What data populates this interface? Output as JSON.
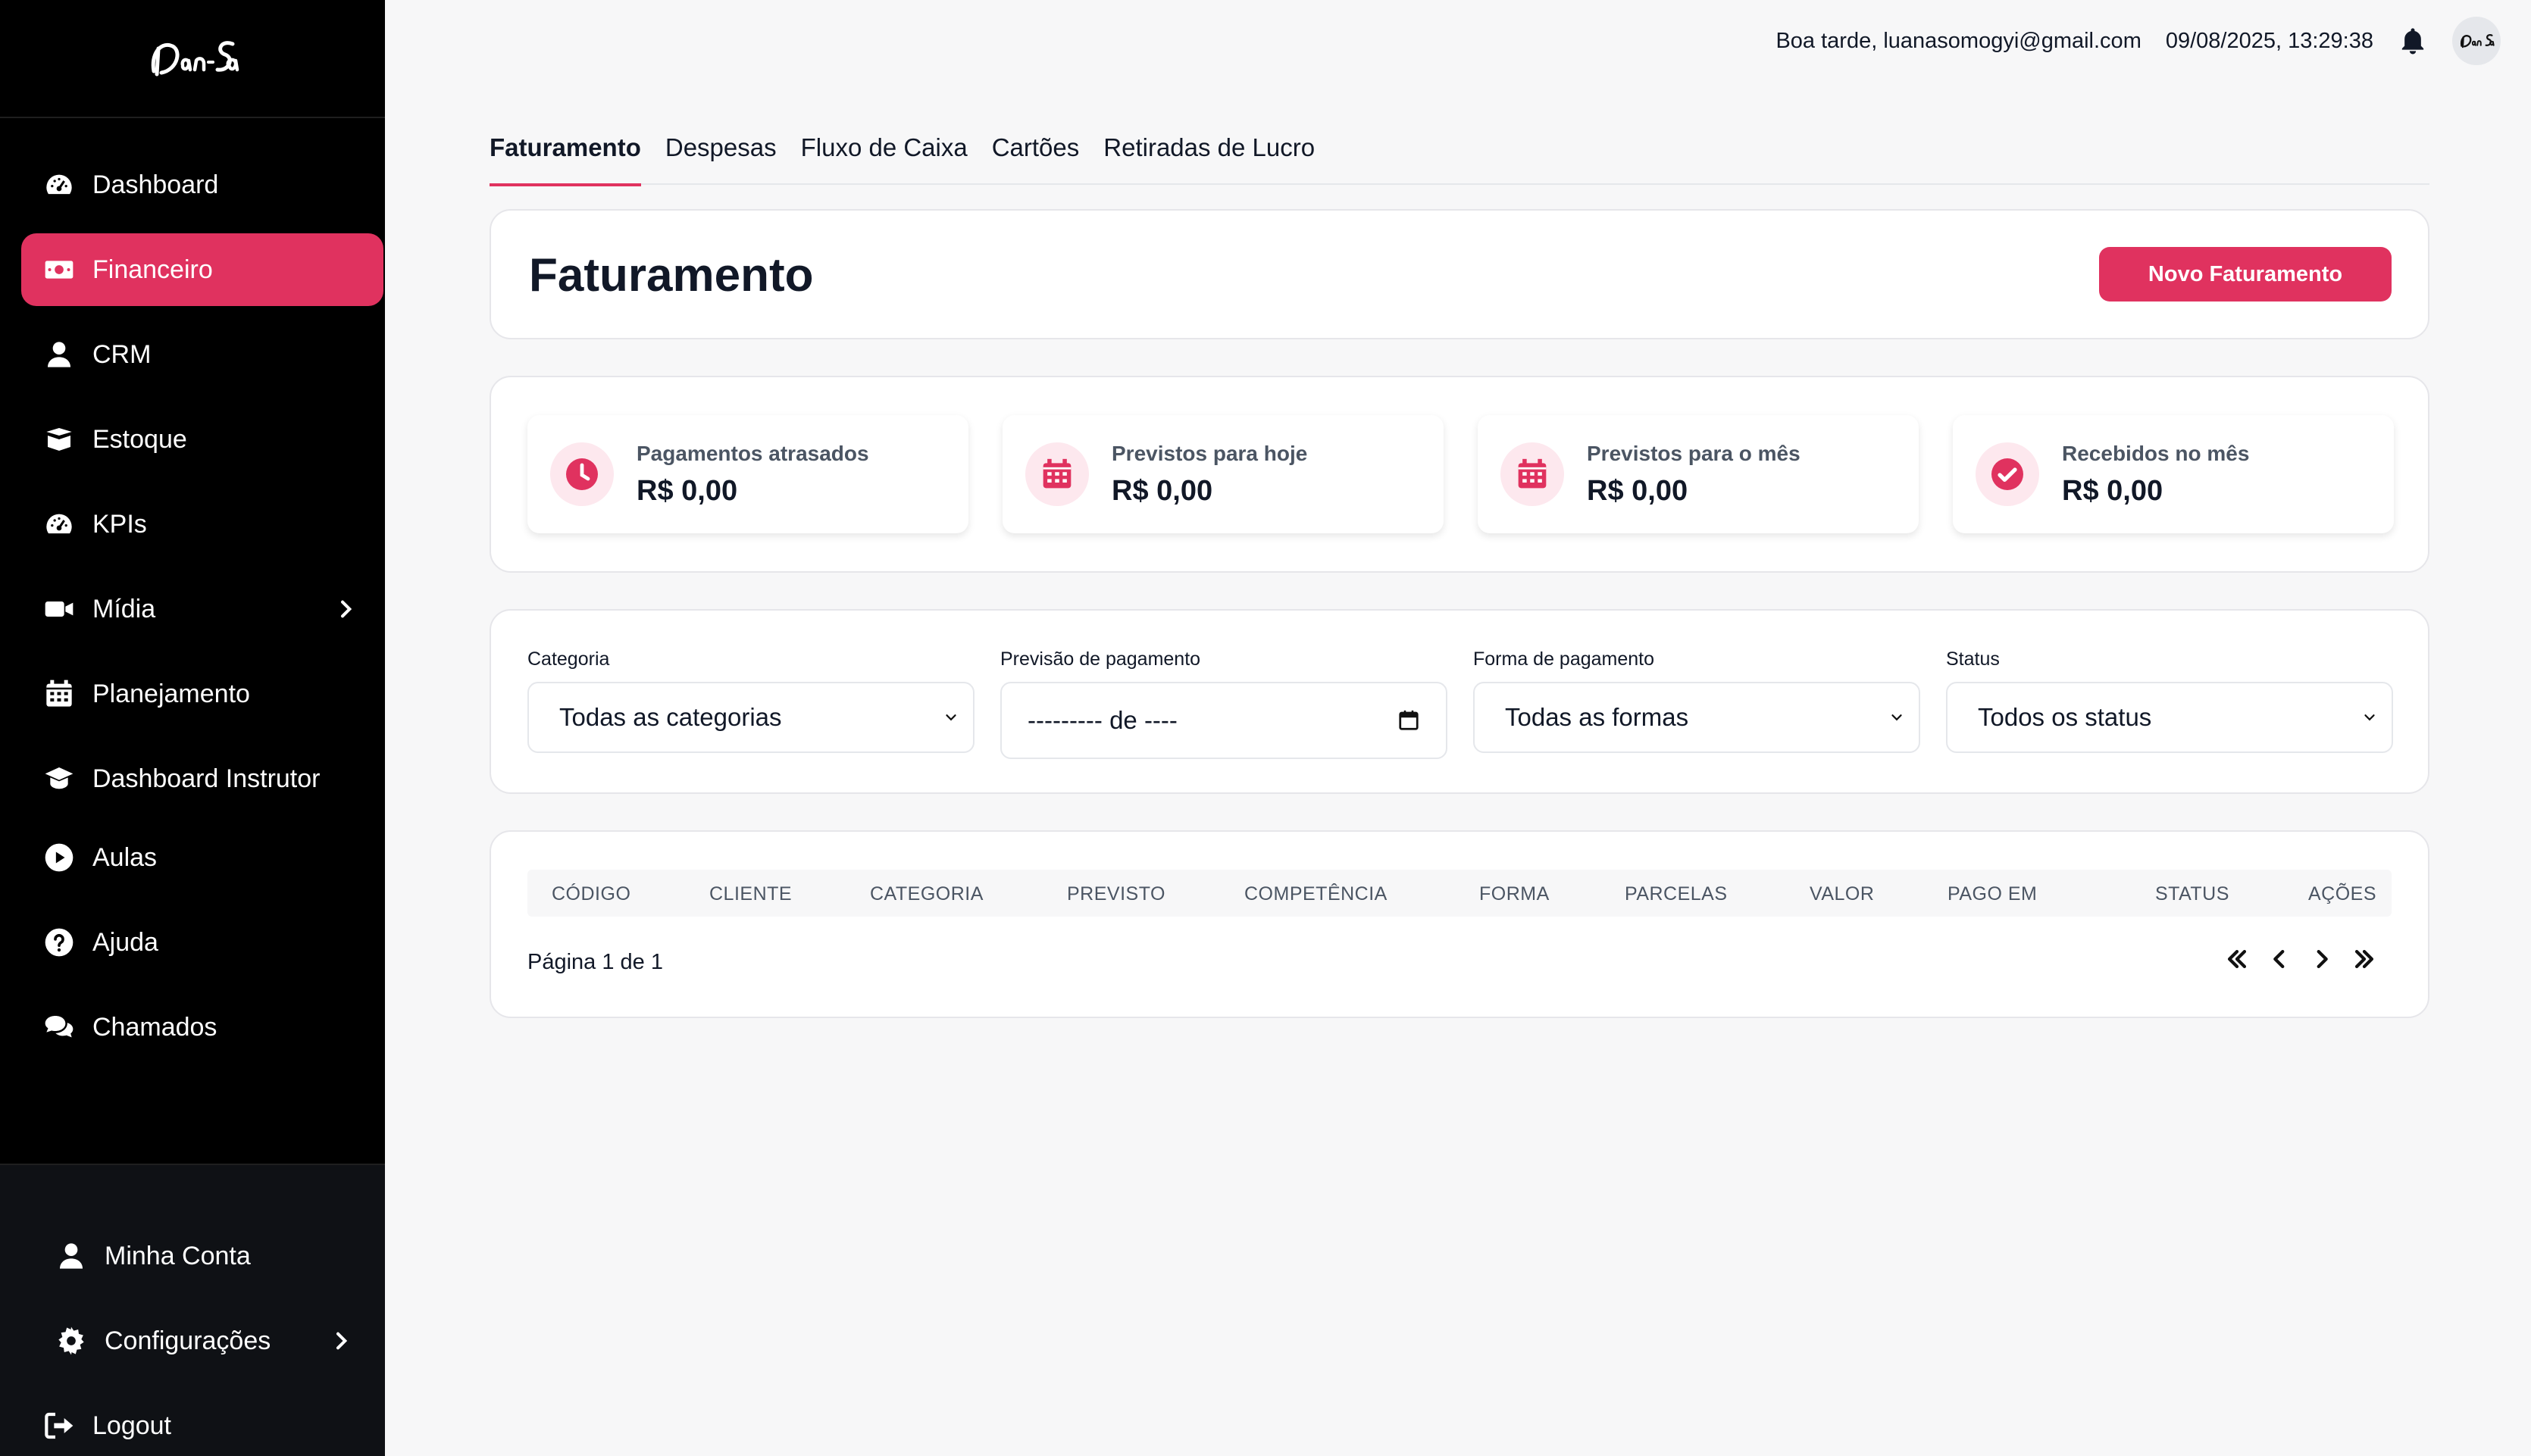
{
  "brand": {
    "logo_text": "Dan Sa"
  },
  "sidebar": {
    "items": [
      {
        "label": "Dashboard",
        "icon": "gauge-icon"
      },
      {
        "label": "Financeiro",
        "icon": "money-bill-icon",
        "active": true
      },
      {
        "label": "CRM",
        "icon": "user-icon"
      },
      {
        "label": "Estoque",
        "icon": "box-icon"
      },
      {
        "label": "KPIs",
        "icon": "gauge-icon"
      },
      {
        "label": "Mídia",
        "icon": "video-icon",
        "has_submenu": true
      },
      {
        "label": "Planejamento",
        "icon": "calendar-icon"
      },
      {
        "label": "Dashboard Instrutor",
        "icon": "graduation-cap-icon"
      },
      {
        "label": "Aulas",
        "icon": "play-circle-icon"
      },
      {
        "label": "Ajuda",
        "icon": "question-circle-icon"
      },
      {
        "label": "Chamados",
        "icon": "comments-icon"
      }
    ],
    "bottom": [
      {
        "label": "Minha Conta",
        "icon": "user-icon"
      },
      {
        "label": "Configurações",
        "icon": "gear-icon",
        "has_submenu": true
      },
      {
        "label": "Logout",
        "icon": "logout-icon"
      }
    ]
  },
  "header": {
    "greeting": "Boa tarde, luanasomogyi@gmail.com",
    "datetime": "09/08/2025, 13:29:38",
    "notification_icon": "bell-icon"
  },
  "tabs": [
    {
      "label": "Faturamento",
      "active": true
    },
    {
      "label": "Despesas"
    },
    {
      "label": "Fluxo de Caixa"
    },
    {
      "label": "Cartões"
    },
    {
      "label": "Retiradas de Lucro"
    }
  ],
  "page": {
    "title": "Faturamento",
    "new_button": "Novo Faturamento"
  },
  "stats": [
    {
      "label": "Pagamentos atrasados",
      "value": "R$ 0,00",
      "icon": "clock-icon"
    },
    {
      "label": "Previstos para hoje",
      "value": "R$ 0,00",
      "icon": "calendar-icon"
    },
    {
      "label": "Previstos para o mês",
      "value": "R$ 0,00",
      "icon": "calendar-icon"
    },
    {
      "label": "Recebidos no mês",
      "value": "R$ 0,00",
      "icon": "check-circle-icon"
    }
  ],
  "filters": {
    "categoria": {
      "label": "Categoria",
      "value": "Todas as categorias"
    },
    "previsao": {
      "label": "Previsão de pagamento",
      "value": "--------- de ----"
    },
    "forma": {
      "label": "Forma de pagamento",
      "value": "Todas as formas"
    },
    "status": {
      "label": "Status",
      "value": "Todos os status"
    }
  },
  "table": {
    "columns": [
      "CÓDIGO",
      "CLIENTE",
      "CATEGORIA",
      "PREVISTO",
      "COMPETÊNCIA",
      "FORMA",
      "PARCELAS",
      "VALOR",
      "PAGO EM",
      "STATUS",
      "AÇÕES"
    ],
    "rows": [],
    "pagination": "Página 1 de 1"
  },
  "colors": {
    "accent": "#e0325f",
    "sidebar_bg": "#000000",
    "page_bg": "#f7f7f8"
  }
}
